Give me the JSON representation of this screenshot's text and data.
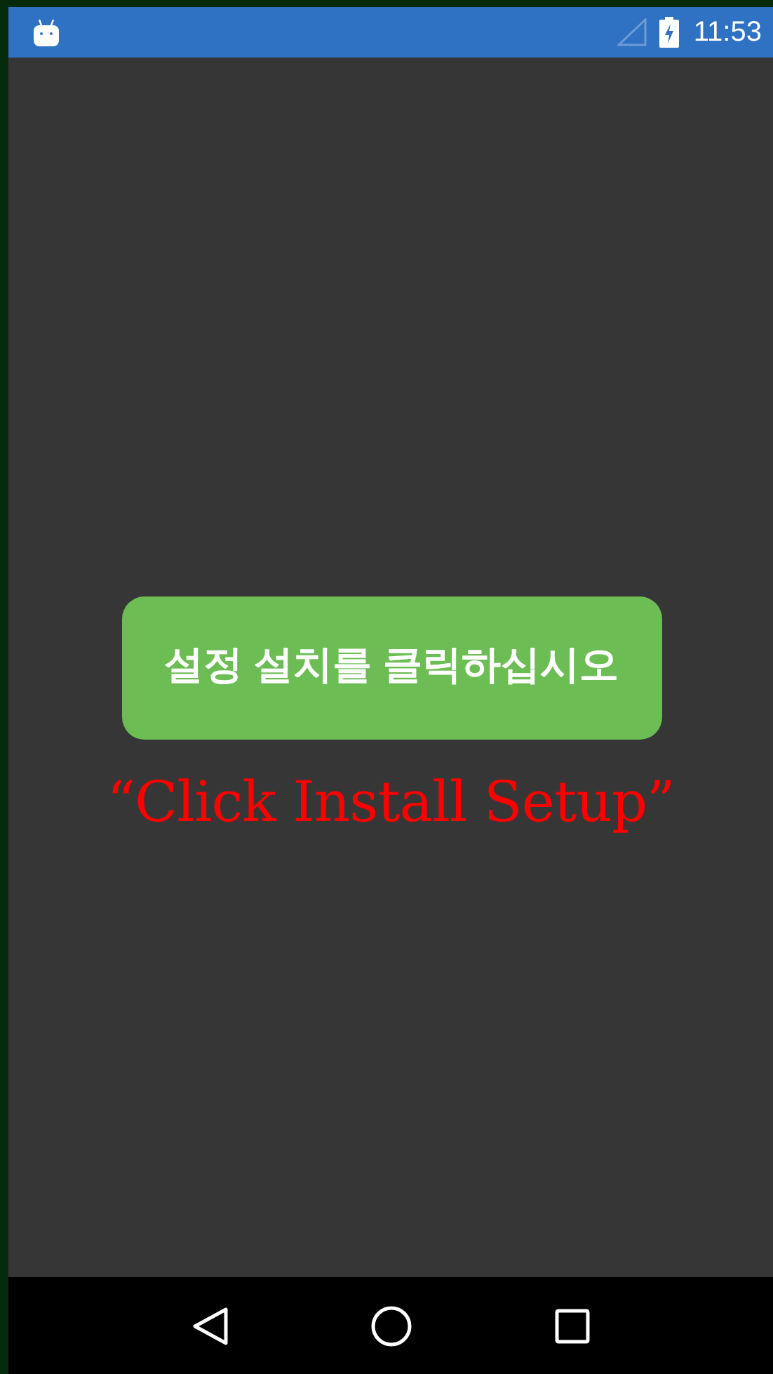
{
  "status_bar": {
    "time": "11:53"
  },
  "install_button": {
    "label": "설정 설치를 클릭하십시오"
  },
  "caption": "“Click Install Setup”"
}
